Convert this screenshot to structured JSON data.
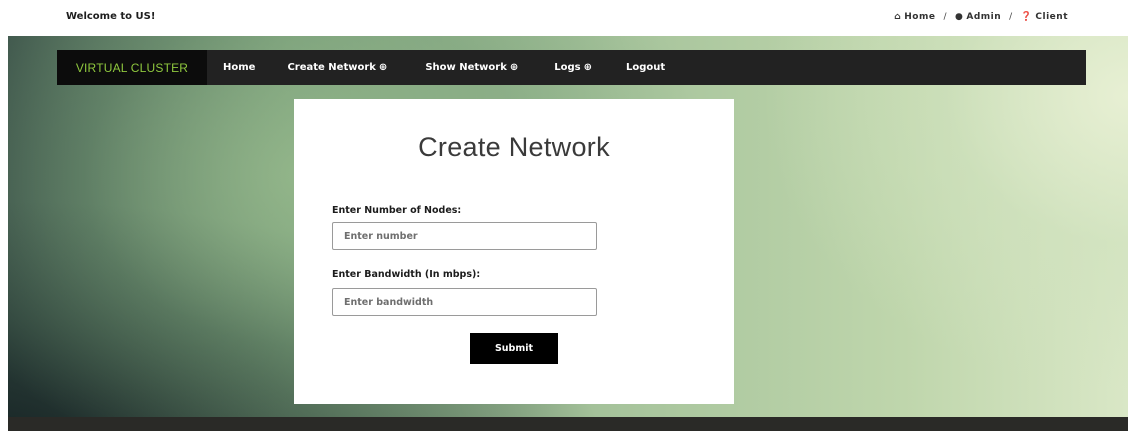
{
  "topbar": {
    "welcome": "Welcome to US!",
    "links": [
      {
        "icon": "home-icon",
        "glyph": "⌂",
        "label": "Home"
      },
      {
        "icon": "users-icon",
        "glyph": "●",
        "label": "Admin"
      },
      {
        "icon": "question-icon",
        "glyph": "❓",
        "label": "Client"
      }
    ],
    "separator": "/"
  },
  "navbar": {
    "brand": "VIRTUAL CLUSTER",
    "brand_color": "#8fc83e",
    "items": [
      {
        "label": "Home",
        "icon": ""
      },
      {
        "label": "Create Network",
        "icon": "⊕"
      },
      {
        "label": "Show Network",
        "icon": "⊕"
      },
      {
        "label": "Logs",
        "icon": "⊕"
      },
      {
        "label": "Logout",
        "icon": ""
      }
    ]
  },
  "form": {
    "title": "Create Network",
    "nodes_label": "Enter Number of Nodes:",
    "nodes_placeholder": "Enter number",
    "nodes_value": "",
    "bandwidth_label": "Enter Bandwidth (In mbps):",
    "bandwidth_placeholder": "Enter bandwidth",
    "bandwidth_value": "",
    "submit_label": "Submit"
  }
}
